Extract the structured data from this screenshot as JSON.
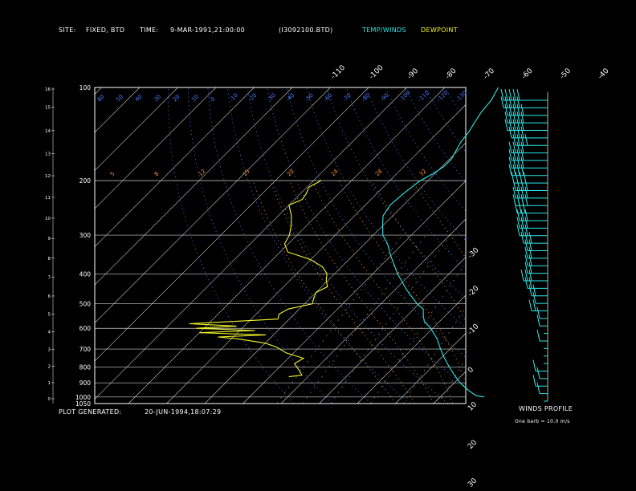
{
  "header": {
    "site_label": "SITE:",
    "site_value": "FIXED, BTD",
    "time_label": "TIME:",
    "time_value": "9-MAR-1991,21:00:00",
    "file": "(I3092100.BTD)",
    "legend_temp_winds": "TEMP/WINDS",
    "legend_dewpoint": "DEWPOINT"
  },
  "footer": {
    "generated_label": "PLOT GENERATED:",
    "generated_value": "20-JUN-1994,18:07:29",
    "winds_title": "WINDS PROFILE",
    "barb_note": "One barb = 10.0 m/s"
  },
  "colors": {
    "temperature": "#2fe6e6",
    "dewpoint": "#f4f42a",
    "isotherm": "#cfcfcf",
    "dry_adiabat": "#4a7cff",
    "moist_adiabat": "#ff8a3a",
    "mixing_ratio": "#9a9a9a",
    "frame": "#ffffff",
    "winds": "#2fe6e6"
  },
  "chart_data": {
    "type": "skew-t",
    "pressure_levels": [
      "100",
      "200",
      "300",
      "400",
      "500",
      "600",
      "700",
      "800",
      "900",
      "1000",
      "1050"
    ],
    "height_km_ticks": [
      "0",
      "1",
      "2",
      "3",
      "4",
      "5",
      "6",
      "7",
      "8",
      "9",
      "10",
      "11",
      "12",
      "13",
      "14",
      "15",
      "16"
    ],
    "top_temp_labels": [
      "-110",
      "-100",
      "-90",
      "-80",
      "-70",
      "-60",
      "-50",
      "-40"
    ],
    "right_temp_labels": [
      "-30",
      "-20",
      "-10",
      "0",
      "10",
      "20",
      "30"
    ],
    "dry_adiabat_labels": [
      "60",
      "50",
      "40",
      "30",
      "20",
      "10",
      "0",
      "-10",
      "-20",
      "-30",
      "-40",
      "-50",
      "-60",
      "-70",
      "-80",
      "-90",
      "-100",
      "-110",
      "-120",
      "-130",
      "-140"
    ],
    "moist_adiabat_labels": [
      "5",
      "8",
      "12",
      "15",
      "20",
      "24",
      "28",
      "32"
    ],
    "temperature_profile": [
      {
        "p": 1000,
        "t": 11.5
      },
      {
        "p": 990,
        "t": 9.0
      },
      {
        "p": 950,
        "t": 5.5
      },
      {
        "p": 900,
        "t": 1.5
      },
      {
        "p": 850,
        "t": -2.0
      },
      {
        "p": 800,
        "t": -5.5
      },
      {
        "p": 750,
        "t": -9.0
      },
      {
        "p": 700,
        "t": -12.5
      },
      {
        "p": 650,
        "t": -16.0
      },
      {
        "p": 600,
        "t": -20.5
      },
      {
        "p": 570,
        "t": -24.0
      },
      {
        "p": 550,
        "t": -25.5
      },
      {
        "p": 520,
        "t": -27.5
      },
      {
        "p": 500,
        "t": -30.5
      },
      {
        "p": 450,
        "t": -37.0
      },
      {
        "p": 400,
        "t": -43.5
      },
      {
        "p": 350,
        "t": -50.0
      },
      {
        "p": 320,
        "t": -54.0
      },
      {
        "p": 300,
        "t": -57.5
      },
      {
        "p": 280,
        "t": -60.0
      },
      {
        "p": 260,
        "t": -62.5
      },
      {
        "p": 240,
        "t": -63.5
      },
      {
        "p": 220,
        "t": -63.0
      },
      {
        "p": 200,
        "t": -62.0
      },
      {
        "p": 190,
        "t": -60.5
      },
      {
        "p": 180,
        "t": -59.5
      },
      {
        "p": 170,
        "t": -59.5
      },
      {
        "p": 160,
        "t": -60.5
      },
      {
        "p": 150,
        "t": -61.5
      },
      {
        "p": 140,
        "t": -62.0
      },
      {
        "p": 130,
        "t": -63.0
      },
      {
        "p": 120,
        "t": -64.0
      },
      {
        "p": 110,
        "t": -64.5
      },
      {
        "p": 100,
        "t": -66.0
      }
    ],
    "dewpoint_profile": [
      {
        "p": 860,
        "t": -45.0
      },
      {
        "p": 850,
        "t": -42.0
      },
      {
        "p": 820,
        "t": -44.0
      },
      {
        "p": 780,
        "t": -47.0
      },
      {
        "p": 750,
        "t": -46.0
      },
      {
        "p": 720,
        "t": -52.0
      },
      {
        "p": 690,
        "t": -56.0
      },
      {
        "p": 670,
        "t": -60.0
      },
      {
        "p": 650,
        "t": -68.0
      },
      {
        "p": 640,
        "t": -74.0
      },
      {
        "p": 630,
        "t": -62.0
      },
      {
        "p": 620,
        "t": -80.0
      },
      {
        "p": 610,
        "t": -66.0
      },
      {
        "p": 600,
        "t": -82.0
      },
      {
        "p": 590,
        "t": -72.0
      },
      {
        "p": 580,
        "t": -85.0
      },
      {
        "p": 560,
        "t": -63.0
      },
      {
        "p": 540,
        "t": -64.0
      },
      {
        "p": 520,
        "t": -63.0
      },
      {
        "p": 500,
        "t": -58.0
      },
      {
        "p": 480,
        "t": -59.0
      },
      {
        "p": 460,
        "t": -60.0
      },
      {
        "p": 440,
        "t": -58.5
      },
      {
        "p": 420,
        "t": -60.5
      },
      {
        "p": 400,
        "t": -62.0
      },
      {
        "p": 380,
        "t": -65.0
      },
      {
        "p": 360,
        "t": -70.0
      },
      {
        "p": 340,
        "t": -78.0
      },
      {
        "p": 320,
        "t": -81.0
      },
      {
        "p": 300,
        "t": -82.0
      },
      {
        "p": 280,
        "t": -84.0
      },
      {
        "p": 260,
        "t": -86.5
      },
      {
        "p": 240,
        "t": -90.0
      },
      {
        "p": 230,
        "t": -88.0
      },
      {
        "p": 220,
        "t": -88.5
      },
      {
        "p": 210,
        "t": -89.5
      },
      {
        "p": 200,
        "t": -88.0
      }
    ],
    "wind_speeds_ms": [
      55,
      55,
      50,
      50,
      50,
      45,
      40,
      45,
      45,
      45,
      45,
      42,
      40,
      40,
      40,
      38,
      35,
      35,
      35,
      30,
      25,
      25,
      25,
      25,
      30,
      25,
      20,
      15,
      20,
      10,
      10,
      5,
      10,
      5,
      5,
      5,
      15,
      10,
      15,
      10,
      5
    ]
  }
}
